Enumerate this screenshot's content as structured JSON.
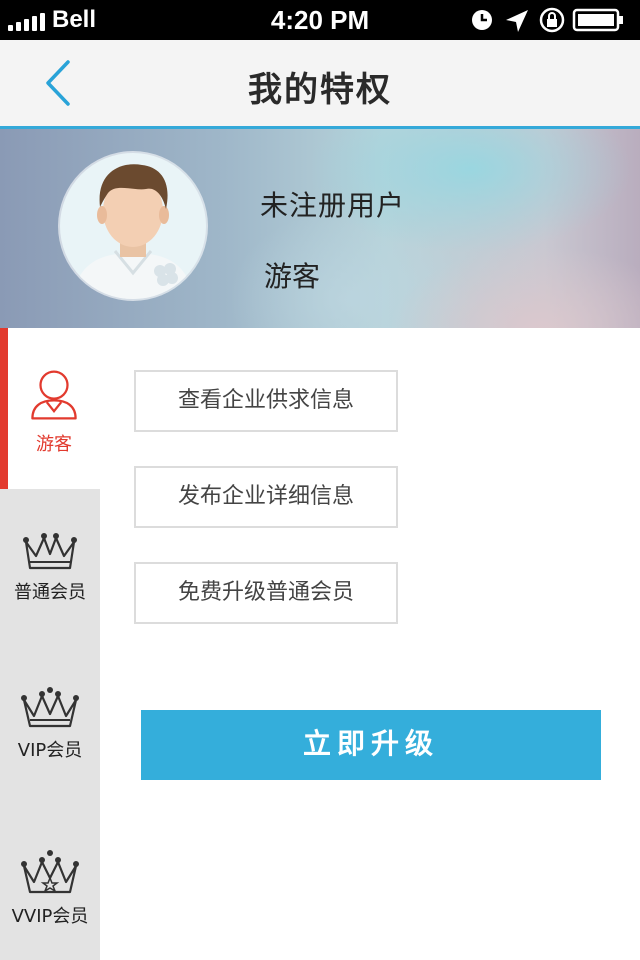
{
  "status_bar": {
    "carrier": "Bell",
    "time": "4:20 PM"
  },
  "nav": {
    "title": "我的特权"
  },
  "profile": {
    "name": "未注册用户",
    "level": "游客"
  },
  "sidebar": {
    "items": [
      {
        "label": "游客",
        "icon": "person-icon",
        "active": true
      },
      {
        "label": "普通会员",
        "icon": "crown-icon",
        "active": false
      },
      {
        "label": "VIP会员",
        "icon": "crown-icon",
        "active": false
      },
      {
        "label": "VVIP会员",
        "icon": "crown-star-icon",
        "active": false
      }
    ]
  },
  "privileges": [
    {
      "label": "查看企业供求信息"
    },
    {
      "label": "发布企业详细信息"
    },
    {
      "label": "免费升级普通会员"
    }
  ],
  "upgrade_button": {
    "label": "立即升级"
  },
  "colors": {
    "accent": "#34aedb",
    "active": "#e23a2e",
    "sidebar_bg": "#e3e3e3"
  }
}
